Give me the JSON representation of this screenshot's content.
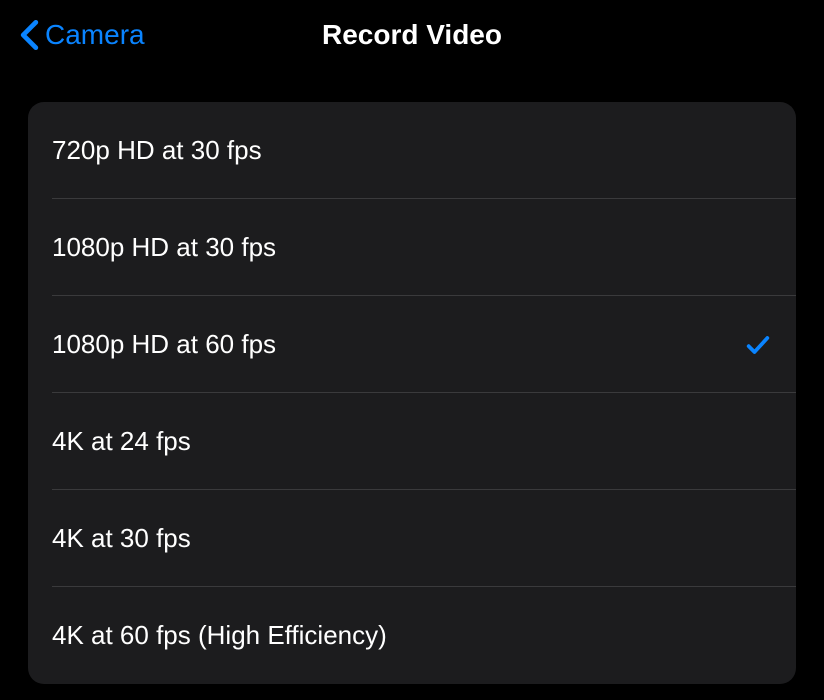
{
  "header": {
    "back_label": "Camera",
    "title": "Record Video"
  },
  "options": [
    {
      "label": "720p HD at 30 fps",
      "selected": false
    },
    {
      "label": "1080p HD at 30 fps",
      "selected": false
    },
    {
      "label": "1080p HD at 60 fps",
      "selected": true
    },
    {
      "label": "4K at 24 fps",
      "selected": false
    },
    {
      "label": "4K at 30 fps",
      "selected": false
    },
    {
      "label": "4K at 60 fps (High Efficiency)",
      "selected": false
    }
  ]
}
